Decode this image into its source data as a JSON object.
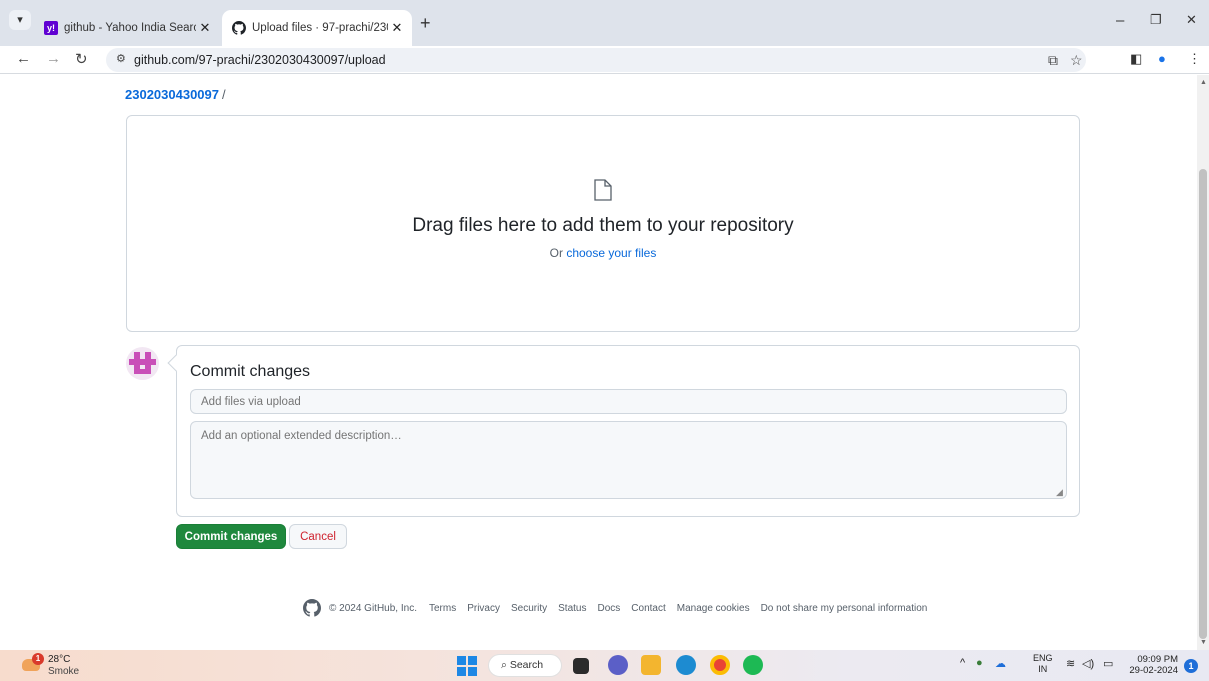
{
  "browser": {
    "tab_menu_icon": "chevron-down",
    "tabs": [
      {
        "title": "github - Yahoo India Search Res",
        "favicon": "yahoo-icon"
      },
      {
        "title": "Upload files · 97-prachi/230203",
        "favicon": "github-icon"
      }
    ],
    "url": "github.com/97-prachi/2302030430097/upload"
  },
  "page": {
    "breadcrumb": {
      "repo": "2302030430097",
      "separator": "/"
    },
    "dropzone": {
      "title": "Drag files here to add them to your repository",
      "sub_prefix": "Or ",
      "sub_link": "choose your files"
    },
    "commit": {
      "heading": "Commit changes",
      "summary_placeholder": "Add files via upload",
      "description_placeholder": "Add an optional extended description…",
      "commit_button": "Commit changes",
      "cancel_button": "Cancel"
    },
    "footer": {
      "copyright": "© 2024 GitHub, Inc.",
      "links": [
        "Terms",
        "Privacy",
        "Security",
        "Status",
        "Docs",
        "Contact",
        "Manage cookies",
        "Do not share my personal information"
      ]
    }
  },
  "taskbar": {
    "weather": {
      "badge": "1",
      "temp": "28°C",
      "condition": "Smoke"
    },
    "search_label": "Search",
    "lang_top": "ENG",
    "lang_bottom": "IN",
    "time": "09:09 PM",
    "date": "29-02-2024",
    "notification_count": "1"
  },
  "colors": {
    "link": "#0969da",
    "commit_green": "#1f883d",
    "cancel_red": "#cf222e",
    "avatar_pink": "#c94fb8"
  }
}
